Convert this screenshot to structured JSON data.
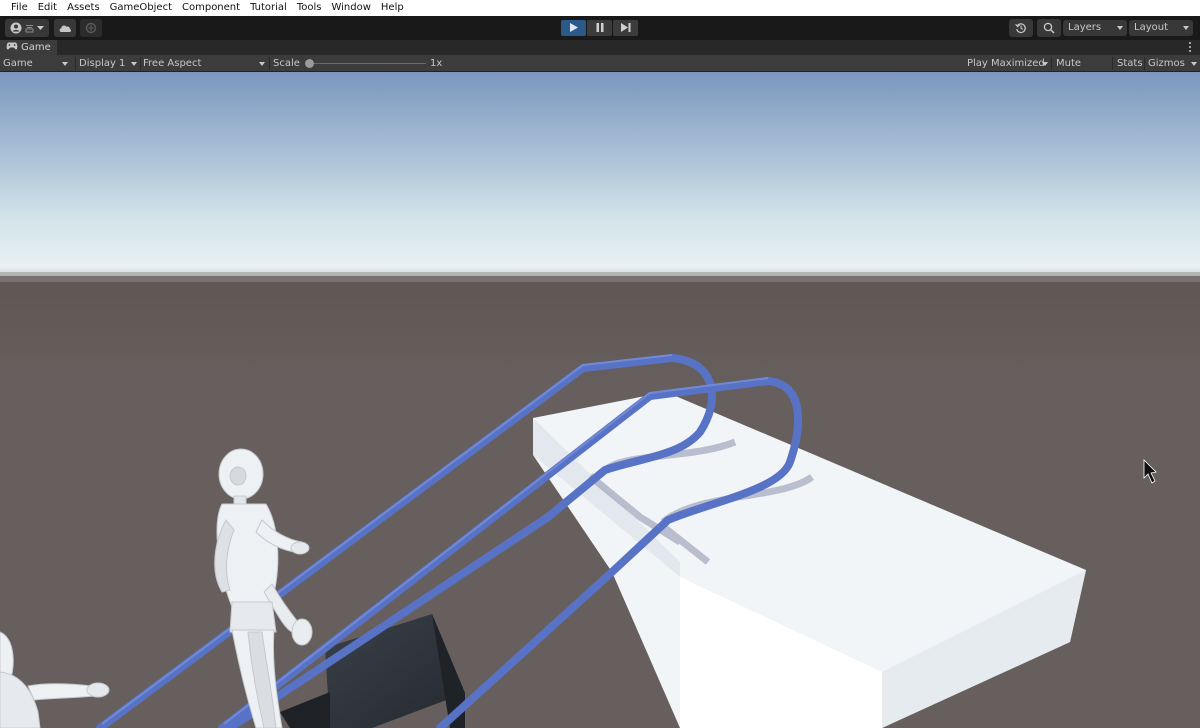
{
  "menubar": {
    "items": [
      "File",
      "Edit",
      "Assets",
      "GameObject",
      "Component",
      "Tutorial",
      "Tools",
      "Window",
      "Help"
    ]
  },
  "toolbar": {
    "account_icon": "account-icon",
    "cloud_icon": "cloud-icon",
    "collab_icon": "collab-icon",
    "play_icon": "play-icon",
    "pause_icon": "pause-icon",
    "step_icon": "step-icon",
    "history_icon": "history-icon",
    "search_icon": "search-icon",
    "layers_label": "Layers",
    "layout_label": "Layout",
    "accent_color": "#2b5a8a"
  },
  "tab": {
    "title": "Game",
    "icon": "gamepad-icon"
  },
  "gamebar": {
    "view_mode": "Game",
    "display": "Display 1",
    "aspect": "Free Aspect",
    "scale_label": "Scale",
    "scale_value": "1x",
    "scale_fraction": 0.0,
    "play_maximized": "Play Maximized",
    "mute_audio": "Mute Audio",
    "stats": "Stats",
    "gizmos": "Gizmos"
  },
  "scene": {
    "sky_color_top": "#7b96bf",
    "horizon_color": "#e8f1f3",
    "ground_color": "#675f5d",
    "rail_color": "#5a74c8",
    "platform_color": "#f0f4f8",
    "box_color": "#2b3037"
  }
}
